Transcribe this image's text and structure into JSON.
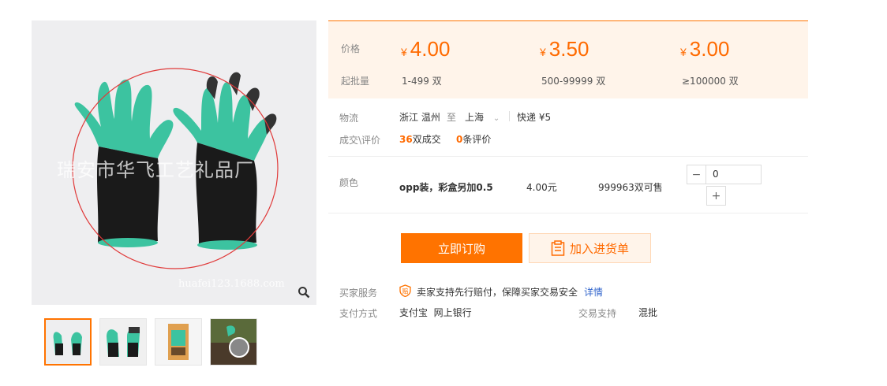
{
  "gallery": {
    "watermark": "瑞安市华飞工艺礼品厂",
    "watermark_url": "huafei123.1688.com",
    "thumb_count": 4
  },
  "price": {
    "label_price": "价格",
    "label_batch": "起批量",
    "currency": "¥",
    "tiers": [
      {
        "price": "4.00",
        "batch": "1-499 双"
      },
      {
        "price": "3.50",
        "batch": "500-99999 双"
      },
      {
        "price": "3.00",
        "batch": "≥100000 双"
      }
    ]
  },
  "logistics": {
    "label": "物流",
    "from": "浙江 温州",
    "to_word": "至",
    "to": "上海",
    "express": "快递 ¥5"
  },
  "deals": {
    "label": "成交\\评价",
    "deal_count": "36",
    "deal_unit": "双成交",
    "review_count": "0",
    "review_unit": "条评价"
  },
  "sku": {
    "label": "颜色",
    "name": "opp装，彩盒另加0.5",
    "price": "4.00元",
    "stock": "999963双可售",
    "qty": "0",
    "minus": "−",
    "plus": "+"
  },
  "actions": {
    "buy": "立即订购",
    "cart": "加入进货单"
  },
  "service": {
    "label": "买家服务",
    "text": "卖家支持先行赔付，保障买家交易安全",
    "link": "详情"
  },
  "payment": {
    "label": "支付方式",
    "methods": "支付宝  网上银行",
    "trade_label": "交易支持",
    "trade_value": "混批"
  },
  "colors": {
    "accent": "#ff7300",
    "price": "#ff6a00",
    "glove_green": "#3cc3a0",
    "glove_black": "#1a1a1a"
  }
}
